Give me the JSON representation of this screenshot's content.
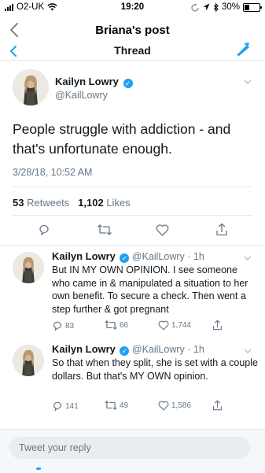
{
  "status_bar": {
    "carrier": "O2-UK",
    "time": "19:20",
    "battery": "30%",
    "battery_level": 0.3
  },
  "nav": {
    "back_icon": "chevron-left-icon",
    "title": "Briana's post"
  },
  "thread_header": {
    "title": "Thread",
    "compose_icon": "compose-icon"
  },
  "main_tweet": {
    "name": "Kailyn Lowry",
    "handle": "@KailLowry",
    "text": "People struggle with addiction - and that's unfortunate enough.",
    "timestamp": "3/28/18, 10:52 AM",
    "retweets_count": "53",
    "retweets_label": "Retweets",
    "likes_count": "1,102",
    "likes_label": "Likes",
    "actions": [
      "reply-icon",
      "retweet-icon",
      "like-icon",
      "share-icon"
    ]
  },
  "replies": [
    {
      "name": "Kailyn Lowry",
      "handle": "@KailLowry",
      "time": "· 1h",
      "text": "But IN MY OWN OPINION. I see someone who came in & manipulated a situation to her own benefit. To secure a check. Then went a step further & got pregnant",
      "reply_count": "83",
      "retweet_count": "66",
      "like_count": "1,744"
    },
    {
      "name": "Kailyn Lowry",
      "handle": "@KailLowry",
      "time": "· 1h",
      "text": "So that when they split, she is set with a couple dollars. But that's MY OWN opinion.",
      "reply_count": "141",
      "retweet_count": "49",
      "like_count": "1,586"
    }
  ],
  "compose": {
    "placeholder": "Tweet your reply"
  },
  "colors": {
    "accent": "#1da1f2",
    "muted": "#657786",
    "divider": "#e1e8ed"
  }
}
